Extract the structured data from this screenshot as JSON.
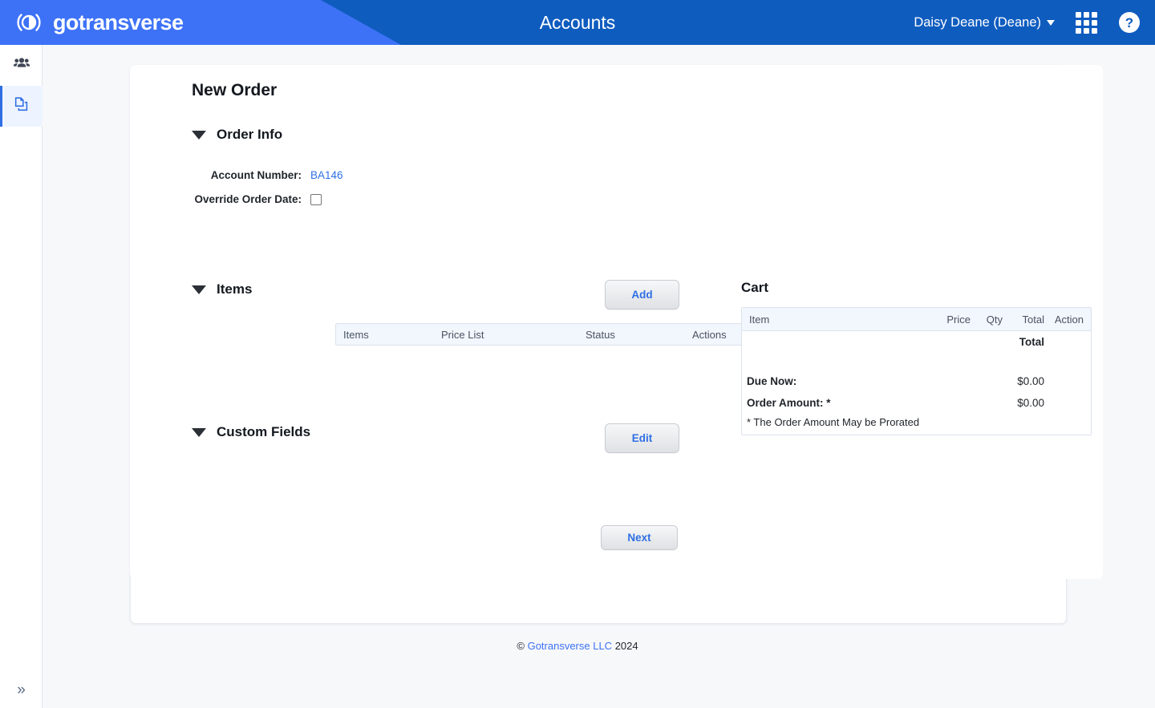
{
  "header": {
    "brand": "gotransverse",
    "brand_logo_icon": "circle-swirl-logo-icon",
    "title": "Accounts",
    "user_menu": "Daisy Deane (Deane)",
    "caret_icon": "chevron-down-icon",
    "apps_icon": "grid-apps-icon",
    "help_icon": "question-mark-help-icon",
    "bg_primary": "#0f5cbf",
    "bg_accent": "#3d72f7"
  },
  "sidebar": {
    "items": [
      {
        "name": "customers",
        "icon": "people-group-icon",
        "active": false
      },
      {
        "name": "orders",
        "icon": "copy-documents-icon",
        "active": true
      }
    ],
    "expand_icon": "double-chevron-right-icon",
    "active_color": "#2f6fe4"
  },
  "main": {
    "page_title": "New Order",
    "sections": {
      "order_info": {
        "label": "Order Info",
        "collapse_icon": "triangle-down-icon",
        "fields": [
          {
            "label": "Account Number:",
            "value": "BA146",
            "type": "link"
          },
          {
            "label": "Override Order Date:",
            "value": "",
            "type": "checkbox",
            "checked": false
          }
        ]
      },
      "items": {
        "label": "Items",
        "collapse_icon": "triangle-down-icon",
        "add_button": "Add",
        "columns": [
          "Items",
          "Price List",
          "Status",
          "Actions"
        ],
        "rows": []
      },
      "custom_fields": {
        "label": "Custom Fields",
        "collapse_icon": "triangle-down-icon",
        "edit_button": "Edit"
      }
    },
    "next_button": "Next"
  },
  "cart": {
    "title": "Cart",
    "columns": [
      "Item",
      "Price",
      "Qty",
      "Total",
      "Action"
    ],
    "total_header": "Total",
    "summary": [
      {
        "label": "Due Now:",
        "value": "$0.00"
      },
      {
        "label": "Order Amount: *",
        "value": "$0.00"
      }
    ],
    "note": "* The Order Amount May be Prorated"
  },
  "footer": {
    "copyright_symbol": "©",
    "link_text": "Gotransverse LLC",
    "year": "2024"
  }
}
